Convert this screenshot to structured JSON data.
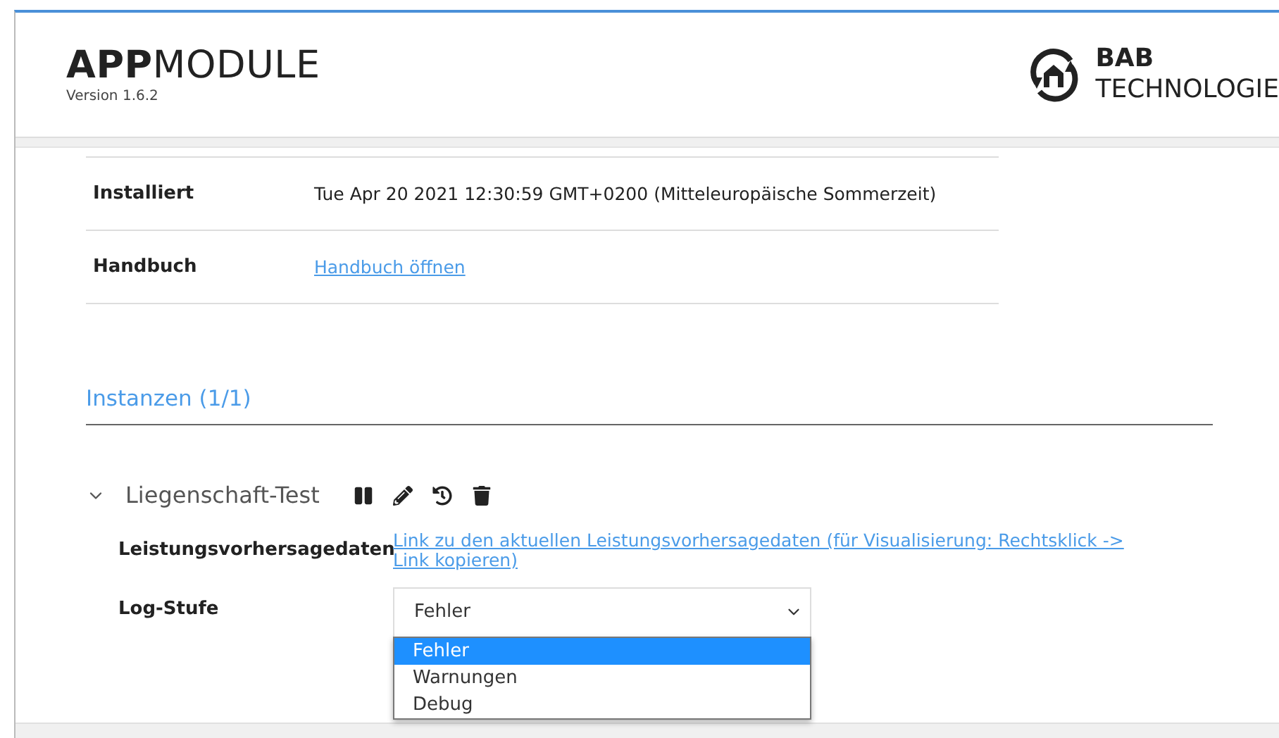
{
  "header": {
    "title": "**APP**MODULE",
    "version": "Version 1.6.2",
    "logo": {
      "line_1": "BAB",
      "line_2": "TECHNOLOGIE"
    }
  },
  "info_rows": [
    {
      "label": "Installiert",
      "value": "Tue Apr 20 2021 12:30:59 GMT+0200 (Mitteleuropäische Sommerzeit)",
      "kind": "text"
    },
    {
      "label": "Handbuch",
      "value": "Handbuch öffnen",
      "kind": "link"
    }
  ],
  "instances_heading": "Instanzen (1/1)",
  "instance": {
    "name": "Liegenschaft-Test",
    "expanded": true,
    "fields": [
      {
        "label": "Leistungsvorhersagedaten",
        "kind": "link",
        "value": "Link zu den aktuellen Leistungsvorhersagedaten (für Visualisierung: Rechtsklick -> Link kopieren)"
      },
      {
        "label": "Log-Stufe",
        "kind": "select",
        "value": "Fehler",
        "expanded": true,
        "options": [
          {
            "label": "Fehler",
            "selected": true
          },
          {
            "label": "Warnungen",
            "selected": false
          },
          {
            "label": "Debug",
            "selected": false
          }
        ]
      }
    ]
  }
}
